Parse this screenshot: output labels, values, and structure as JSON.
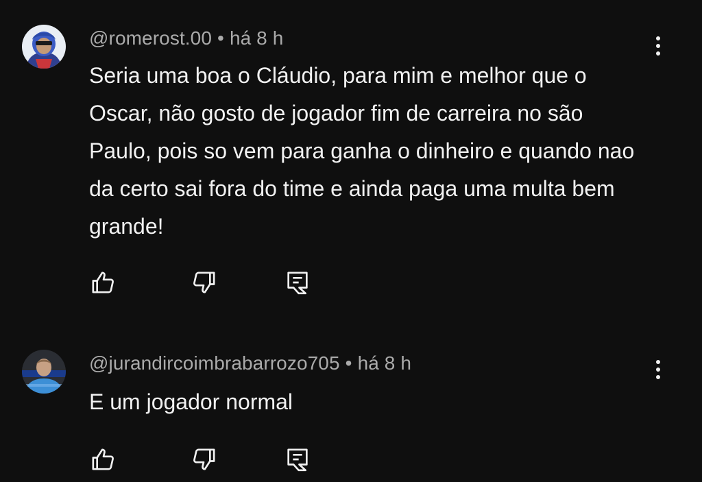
{
  "comments": [
    {
      "author": "@romerost.00",
      "separator": "•",
      "time": "há 8 h",
      "text": "Seria uma boa o Cláudio, para mim e melhor que o Oscar, não gosto de jogador fim de carreira no são Paulo, pois so vem para ganha o dinheiro e quando nao da certo sai fora do time e ainda paga uma multa bem grande!",
      "avatar": "user-avatar",
      "actions": [
        "thumbs-up-icon",
        "thumbs-down-icon",
        "reply-icon"
      ]
    },
    {
      "author": "@jurandircoimbrabarrozo705",
      "separator": "•",
      "time": "há 8 h",
      "text": "E um jogador normal",
      "avatar": "user-avatar",
      "actions": [
        "thumbs-up-icon",
        "thumbs-down-icon",
        "reply-icon"
      ]
    }
  ],
  "colors": {
    "background": "#0f0f0f",
    "text": "#f1f1f1",
    "meta": "#aaaaaa"
  }
}
